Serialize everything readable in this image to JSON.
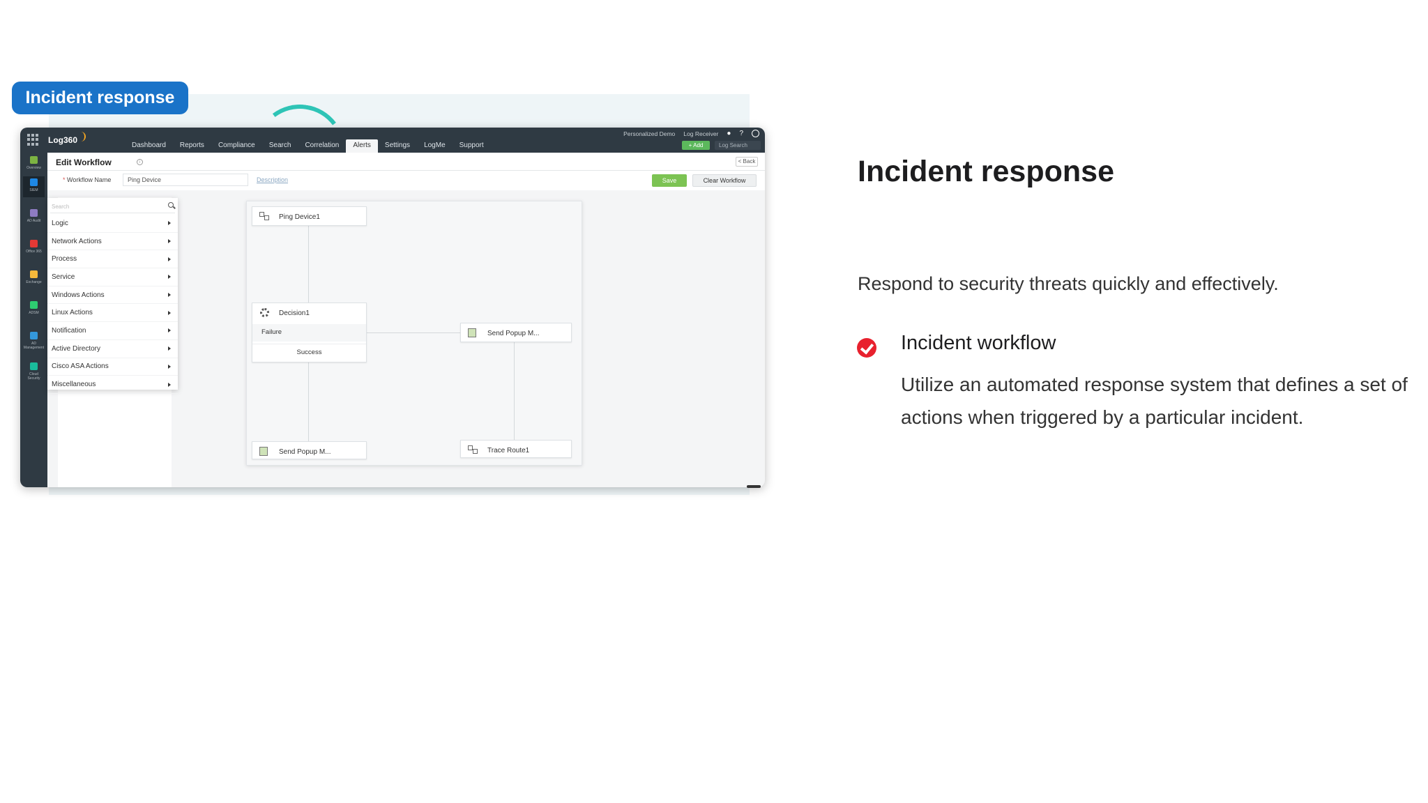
{
  "badge": {
    "label": "Incident response"
  },
  "app": {
    "name": "Log360",
    "nav_tabs": [
      {
        "label": "Dashboard"
      },
      {
        "label": "Reports"
      },
      {
        "label": "Compliance"
      },
      {
        "label": "Search"
      },
      {
        "label": "Correlation"
      },
      {
        "label": "Alerts",
        "active": true
      },
      {
        "label": "Settings"
      },
      {
        "label": "LogMe"
      },
      {
        "label": "Support"
      }
    ],
    "topright": {
      "demo": "Personalized Demo",
      "receiver": "Log Receiver",
      "help": "?",
      "add_label": "+ Add",
      "search_placeholder": "Log Search"
    },
    "left_nav": [
      {
        "label": "Overview",
        "color": "#7cb342"
      },
      {
        "label": "SIEM",
        "color": "#1e88e5"
      },
      {
        "label": "AD Audit",
        "color": "#8e7cc3"
      },
      {
        "label": "Office 365",
        "color": "#e53935"
      },
      {
        "label": "Exchange",
        "color": "#f6b93b"
      },
      {
        "label": "ADSM",
        "color": "#2ecc71"
      },
      {
        "label": "AD Management",
        "color": "#3498db"
      },
      {
        "label": "Cloud Security",
        "color": "#1abc9c"
      }
    ],
    "page": {
      "title": "Edit Workflow",
      "info": "i",
      "back_label": "< Back",
      "workflow_name_label": "Workflow Name",
      "workflow_name_value": "Ping Device",
      "description_link": "Description",
      "save_label": "Save",
      "clear_label": "Clear Workflow"
    },
    "palette": {
      "search_placeholder": "Search",
      "items": [
        "Logic",
        "Network Actions",
        "Process",
        "Service",
        "Windows Actions",
        "Linux Actions",
        "Notification",
        "Active Directory",
        "Cisco ASA Actions",
        "Miscellaneous"
      ]
    },
    "canvas": {
      "nodes": {
        "ping": "Ping Device1",
        "decision": "Decision1",
        "failure": "Failure",
        "success": "Success",
        "popup_right": "Send Popup M...",
        "popup_bottom": "Send Popup M...",
        "trace": "Trace Route1"
      }
    }
  },
  "right": {
    "title": "Incident response",
    "subtitle": "Respond to security threats quickly and effectively.",
    "feature": {
      "title": "Incident workflow",
      "description": "Utilize an automated response system that defines a set of actions when triggered by a particular incident."
    }
  },
  "colors": {
    "badge": "#1a73c8",
    "check": "#e8212e",
    "save": "#7cc353",
    "topbar": "#2f3a43"
  }
}
